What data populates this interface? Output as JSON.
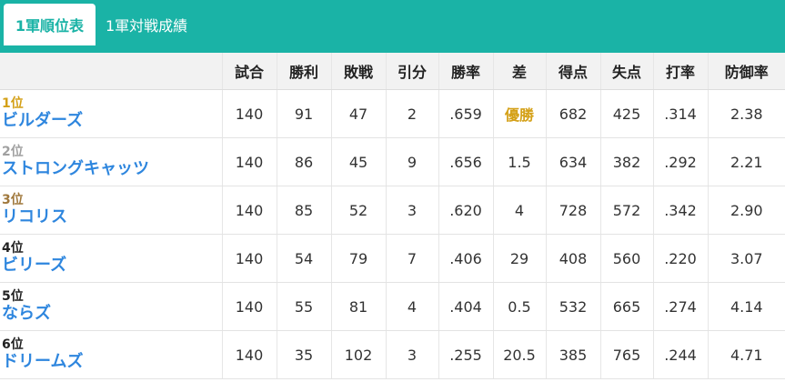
{
  "tabs": [
    {
      "label": "1軍順位表",
      "active": true
    },
    {
      "label": "1軍対戦成績",
      "active": false
    }
  ],
  "columns": [
    "試合",
    "勝利",
    "敗戦",
    "引分",
    "勝率",
    "差",
    "得点",
    "失点",
    "打率",
    "防御率"
  ],
  "rank_colors": [
    "#d4a017",
    "#a0a0a0",
    "#a0783c",
    "#222222",
    "#222222",
    "#222222"
  ],
  "rows": [
    {
      "rank": "1位",
      "team": "ビルダーズ",
      "games": "140",
      "wins": "91",
      "losses": "47",
      "draws": "2",
      "pct": ".659",
      "gb": "優勝",
      "runs": "682",
      "allowed": "425",
      "avg": ".314",
      "era": "2.38"
    },
    {
      "rank": "2位",
      "team": "ストロングキャッツ",
      "games": "140",
      "wins": "86",
      "losses": "45",
      "draws": "9",
      "pct": ".656",
      "gb": "1.5",
      "runs": "634",
      "allowed": "382",
      "avg": ".292",
      "era": "2.21"
    },
    {
      "rank": "3位",
      "team": "リコリス",
      "games": "140",
      "wins": "85",
      "losses": "52",
      "draws": "3",
      "pct": ".620",
      "gb": "4",
      "runs": "728",
      "allowed": "572",
      "avg": ".342",
      "era": "2.90"
    },
    {
      "rank": "4位",
      "team": "ビリーズ",
      "games": "140",
      "wins": "54",
      "losses": "79",
      "draws": "7",
      "pct": ".406",
      "gb": "29",
      "runs": "408",
      "allowed": "560",
      "avg": ".220",
      "era": "3.07"
    },
    {
      "rank": "5位",
      "team": "ならズ",
      "games": "140",
      "wins": "55",
      "losses": "81",
      "draws": "4",
      "pct": ".404",
      "gb": "0.5",
      "runs": "532",
      "allowed": "665",
      "avg": ".274",
      "era": "4.14"
    },
    {
      "rank": "6位",
      "team": "ドリームズ",
      "games": "140",
      "wins": "35",
      "losses": "102",
      "draws": "3",
      "pct": ".255",
      "gb": "20.5",
      "runs": "385",
      "allowed": "765",
      "avg": ".244",
      "era": "4.71"
    }
  ]
}
